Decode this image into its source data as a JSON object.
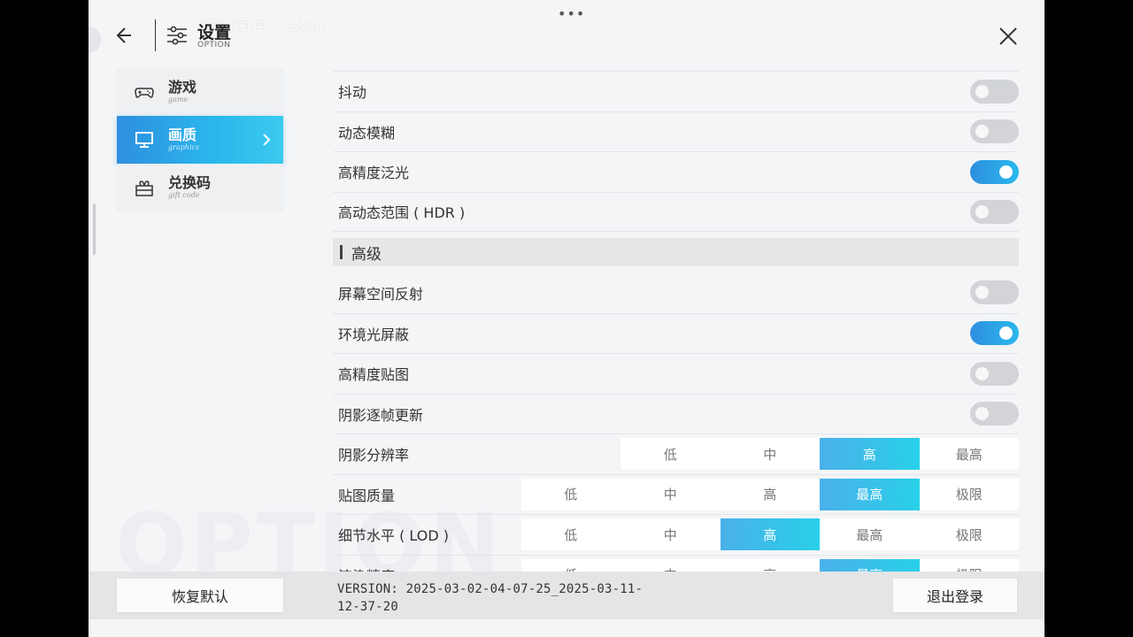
{
  "header": {
    "title": "设置",
    "subtitle": "OPTION",
    "toast": "资源下载中···(18%)",
    "dots": "•••"
  },
  "watermark": "OPTION",
  "sidebar": {
    "items": [
      {
        "label": "游戏",
        "sub": "game",
        "icon": "gamepad-icon",
        "active": false
      },
      {
        "label": "画质",
        "sub": "graphics",
        "icon": "monitor-icon",
        "active": true
      },
      {
        "label": "兑换码",
        "sub": "gift code",
        "icon": "gift-icon",
        "active": false
      }
    ]
  },
  "settings": {
    "toggles_top": [
      {
        "label": "抖动",
        "on": false
      },
      {
        "label": "动态模糊",
        "on": false
      },
      {
        "label": "高精度泛光",
        "on": true
      },
      {
        "label": "高动态范围 ( HDR )",
        "on": false
      }
    ],
    "section_advanced": "高级",
    "toggles_advanced": [
      {
        "label": "屏幕空间反射",
        "on": false
      },
      {
        "label": "环境光屏蔽",
        "on": true
      },
      {
        "label": "高精度贴图",
        "on": false
      },
      {
        "label": "阴影逐帧更新",
        "on": false
      }
    ],
    "segments": [
      {
        "label": "阴影分辨率",
        "options": [
          "低",
          "中",
          "高",
          "最高"
        ],
        "selected": "高"
      },
      {
        "label": "贴图质量",
        "options": [
          "低",
          "中",
          "高",
          "最高",
          "极限"
        ],
        "selected": "最高"
      },
      {
        "label": "细节水平 ( LOD )",
        "options": [
          "低",
          "中",
          "高",
          "最高",
          "极限"
        ],
        "selected": "高"
      },
      {
        "label": "渲染精度",
        "options": [
          "低",
          "中",
          "高",
          "最高",
          "极限"
        ],
        "selected": "最高"
      }
    ]
  },
  "footer": {
    "reset_label": "恢复默认",
    "version": "VERSION: 2025-03-02-04-07-25_2025-03-11-12-37-20",
    "logout_label": "退出登录"
  },
  "colors": {
    "accent_start": "#2e8fe0",
    "accent_end": "#2ab8ec",
    "panel_bg": "#f4f5f7"
  }
}
